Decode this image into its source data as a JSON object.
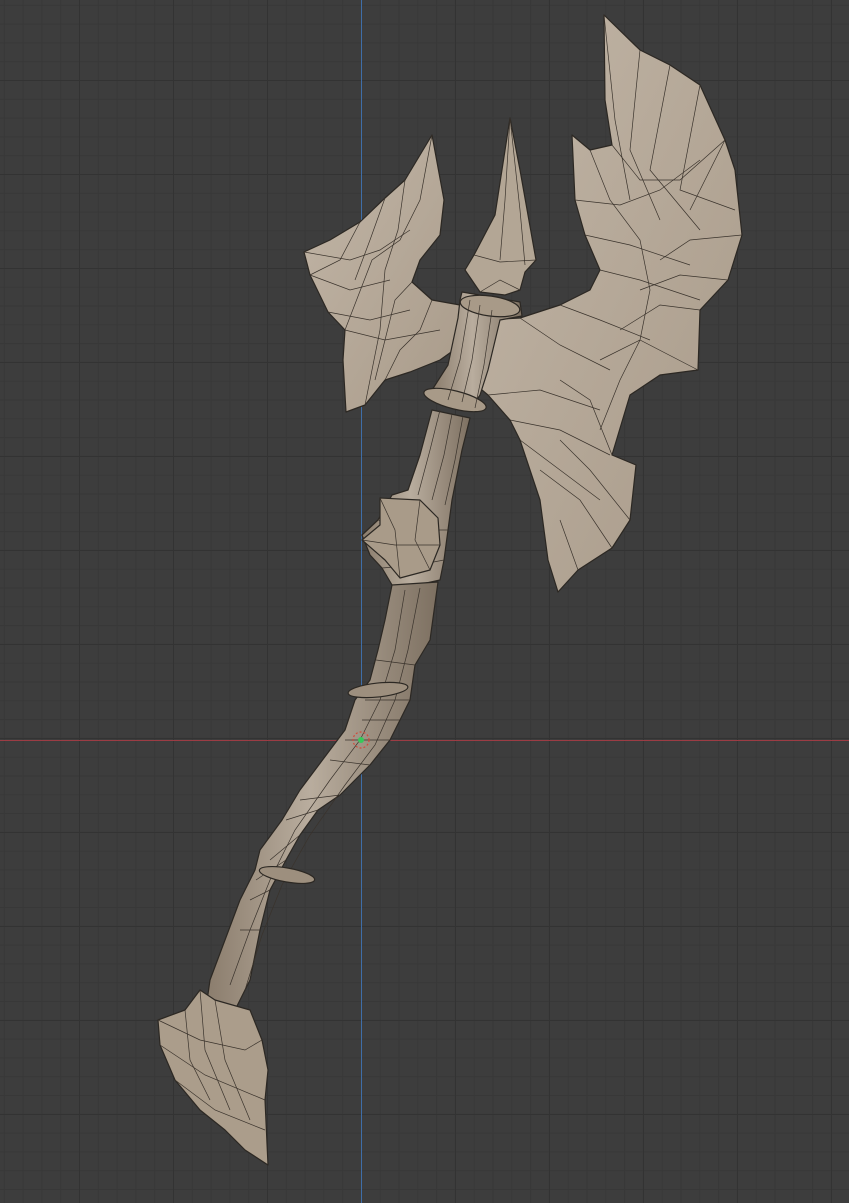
{
  "viewport": {
    "view": "3d-viewport",
    "shading": "solid",
    "grid": true
  },
  "colors": {
    "background": "#3d3d3d",
    "grid_major": "#333333",
    "grid_minor": "#383838",
    "axis_x": "#9c3c44",
    "axis_y": "#3f6ea8",
    "mesh_light": "#b5a898",
    "mesh_mid": "#a19382",
    "mesh_dark": "#7f7263",
    "wire": "#2c2823",
    "origin": "#36c95a"
  },
  "object": {
    "name_icon": "axe-mesh",
    "origin_icon": "object-origin-icon"
  }
}
